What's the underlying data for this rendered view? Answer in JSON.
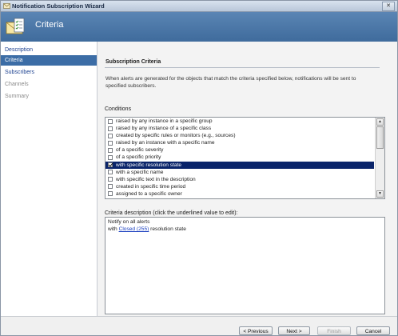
{
  "window": {
    "title": "Notification Subscription Wizard",
    "close_glyph": "✕"
  },
  "header": {
    "title": "Criteria",
    "icon": "envelope-checklist-icon"
  },
  "nav": {
    "items": [
      {
        "label": "Description",
        "state": "link"
      },
      {
        "label": "Criteria",
        "state": "active"
      },
      {
        "label": "Subscribers",
        "state": "link"
      },
      {
        "label": "Channels",
        "state": "disabled"
      },
      {
        "label": "Summary",
        "state": "disabled"
      }
    ]
  },
  "main": {
    "section_title": "Subscription Criteria",
    "description": "When alerts are generated for the objects that match the criteria specified below, notifications will be sent to specified subscribers.",
    "conditions_label": "Conditions",
    "conditions": [
      {
        "label": "raised by any instance in a specific group",
        "checked": false,
        "selected": false
      },
      {
        "label": "raised by any instance of a specific class",
        "checked": false,
        "selected": false
      },
      {
        "label": "created by specific rules or monitors (e.g., sources)",
        "checked": false,
        "selected": false
      },
      {
        "label": "raised by an instance with a specific name",
        "checked": false,
        "selected": false
      },
      {
        "label": "of a specific severity",
        "checked": false,
        "selected": false
      },
      {
        "label": "of a specific priority",
        "checked": false,
        "selected": false
      },
      {
        "label": "with specific resolution state",
        "checked": true,
        "selected": true
      },
      {
        "label": "with a specific name",
        "checked": false,
        "selected": false
      },
      {
        "label": "with specific text in the description",
        "checked": false,
        "selected": false
      },
      {
        "label": "created in specific time period",
        "checked": false,
        "selected": false
      },
      {
        "label": "assigned to a specific owner",
        "checked": false,
        "selected": false
      }
    ],
    "criteria_label": "Criteria description (click the underlined value to edit):",
    "criteria": {
      "line1": "Notify on all alerts",
      "line2_prefix": "with",
      "line2_link": "Closed (255)",
      "line2_suffix": "resolution state"
    }
  },
  "footer": {
    "previous": "< Previous",
    "next": "Next >",
    "finish": "Finish",
    "cancel": "Cancel"
  },
  "colors": {
    "header": "#4a78aa",
    "active_nav": "#3c6da6",
    "selection": "#0a246a"
  }
}
